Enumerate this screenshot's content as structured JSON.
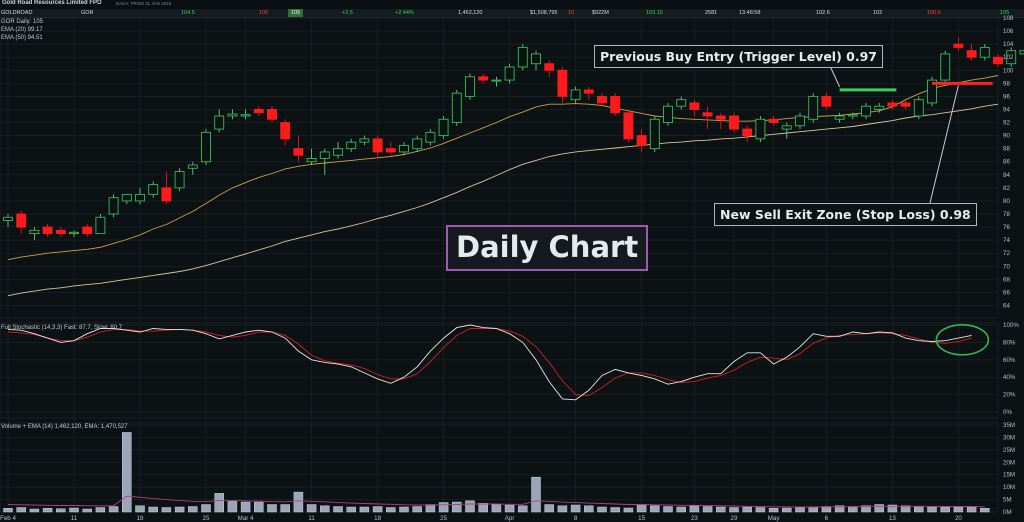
{
  "header": {
    "title": "Gold Road Resources Limited FPO",
    "subtitle": "DAILY, FROM 31 JAN 2019",
    "quotes": [
      {
        "text": "GOLDROAD",
        "kind": "plain"
      },
      {
        "text": "GOR",
        "kind": "plain"
      },
      {
        "text": "104.5",
        "kind": "up"
      },
      {
        "text": "105",
        "kind": "dn"
      },
      {
        "text": "105",
        "kind": "hl"
      },
      {
        "text": "+2.5",
        "kind": "up"
      },
      {
        "text": "+2.44%",
        "kind": "up"
      },
      {
        "text": "1,462,120",
        "kind": "plain"
      },
      {
        "text": "$1,508,795",
        "kind": "plain"
      },
      {
        "text": "10",
        "kind": "dn"
      },
      {
        "text": "$922M",
        "kind": "plain"
      },
      {
        "text": "103.15",
        "kind": "up"
      },
      {
        "text": "2581",
        "kind": "plain"
      },
      {
        "text": "13:48:58",
        "kind": "plain"
      },
      {
        "text": "102.6",
        "kind": "plain"
      },
      {
        "text": "102",
        "kind": "plain"
      },
      {
        "text": "100.6",
        "kind": "dn"
      },
      {
        "text": "105",
        "kind": "up"
      }
    ]
  },
  "annotations": {
    "buy": "Previous Buy Entry (Trigger Level) 0.97",
    "sell": "New Sell Exit Zone (Stop Loss) 0.98",
    "big": "Daily Chart"
  },
  "panel_labels": {
    "price": [
      "GOR Daily: 105",
      "EMA (20) 99.17",
      "EMA (50) 94.51"
    ],
    "stoch": "Full Stochastic (14,3,3) Fast: 87.7, Slow: 80.7",
    "volume": "Volume + EMA (14) 1,462,120, EMA: 1,470,527"
  },
  "colors": {
    "up_candle": "#2fbf55",
    "down_candle": "#ff1b1b",
    "ema20": "#c9a24a",
    "ema50": "#d9c69a",
    "stoch_fast": "#e6e6e6",
    "stoch_slow": "#cc2222",
    "volume_bar": "#9aa6b8",
    "volume_ema": "#b0407f",
    "buy_level": "#36d15a",
    "sell_level": "#ff2222",
    "highlight_circle": "#2fb84f"
  },
  "chart_data": [
    {
      "type": "candlestick",
      "title": "",
      "ylim": [
        63,
        108
      ],
      "y_ticks": [
        64,
        66,
        68,
        70,
        72,
        74,
        76,
        78,
        80,
        82,
        84,
        86,
        88,
        90,
        92,
        94,
        96,
        98,
        100,
        102,
        104,
        106,
        108
      ],
      "x_tick_labels": [
        {
          "label": "Feb 4",
          "idx": 0
        },
        {
          "label": "11",
          "idx": 5
        },
        {
          "label": "18",
          "idx": 10
        },
        {
          "label": "25",
          "idx": 15
        },
        {
          "label": "Mar 4",
          "idx": 18
        },
        {
          "label": "11",
          "idx": 23
        },
        {
          "label": "18",
          "idx": 28
        },
        {
          "label": "25",
          "idx": 33
        },
        {
          "label": "Apr",
          "idx": 38
        },
        {
          "label": "8",
          "idx": 43
        },
        {
          "label": "15",
          "idx": 48
        },
        {
          "label": "23",
          "idx": 52
        },
        {
          "label": "29",
          "idx": 55
        },
        {
          "label": "May",
          "idx": 58
        },
        {
          "label": "6",
          "idx": 62
        },
        {
          "label": "13",
          "idx": 67
        },
        {
          "label": "20",
          "idx": 72
        }
      ],
      "ohlc": [
        {
          "o": 77,
          "h": 78,
          "l": 76,
          "c": 77.5
        },
        {
          "o": 78,
          "h": 78.5,
          "l": 75,
          "c": 76
        },
        {
          "o": 75,
          "h": 76,
          "l": 74,
          "c": 75.5
        },
        {
          "o": 76,
          "h": 76.5,
          "l": 74.5,
          "c": 75
        },
        {
          "o": 75.5,
          "h": 76,
          "l": 74.5,
          "c": 75
        },
        {
          "o": 75,
          "h": 75.5,
          "l": 74.5,
          "c": 75.2
        },
        {
          "o": 76,
          "h": 76.5,
          "l": 74.5,
          "c": 75
        },
        {
          "o": 75,
          "h": 78,
          "l": 75,
          "c": 77.5
        },
        {
          "o": 78,
          "h": 81,
          "l": 77.5,
          "c": 80.5
        },
        {
          "o": 80,
          "h": 81,
          "l": 79.5,
          "c": 81
        },
        {
          "o": 80,
          "h": 82,
          "l": 79.5,
          "c": 81
        },
        {
          "o": 81,
          "h": 83,
          "l": 80.5,
          "c": 82.5
        },
        {
          "o": 82,
          "h": 84.5,
          "l": 79.5,
          "c": 80
        },
        {
          "o": 82,
          "h": 85,
          "l": 81.5,
          "c": 84.5
        },
        {
          "o": 85,
          "h": 86,
          "l": 84,
          "c": 85.5
        },
        {
          "o": 86,
          "h": 91,
          "l": 85.5,
          "c": 90.5
        },
        {
          "o": 91,
          "h": 94,
          "l": 90.5,
          "c": 93
        },
        {
          "o": 93,
          "h": 94,
          "l": 92.5,
          "c": 93.3
        },
        {
          "o": 93,
          "h": 94,
          "l": 92.5,
          "c": 93.2
        },
        {
          "o": 94,
          "h": 94.5,
          "l": 93,
          "c": 93.5
        },
        {
          "o": 94,
          "h": 94.5,
          "l": 92,
          "c": 92.5
        },
        {
          "o": 92,
          "h": 92.5,
          "l": 88.5,
          "c": 89.5
        },
        {
          "o": 88,
          "h": 90,
          "l": 86,
          "c": 87
        },
        {
          "o": 86,
          "h": 88,
          "l": 85.5,
          "c": 86.5
        },
        {
          "o": 86.5,
          "h": 88,
          "l": 84,
          "c": 87.5
        },
        {
          "o": 87,
          "h": 89,
          "l": 86.5,
          "c": 88
        },
        {
          "o": 88,
          "h": 89.5,
          "l": 87.5,
          "c": 89
        },
        {
          "o": 89,
          "h": 90,
          "l": 88.5,
          "c": 89.5
        },
        {
          "o": 89.5,
          "h": 90,
          "l": 86.5,
          "c": 87.5
        },
        {
          "o": 88,
          "h": 89,
          "l": 87,
          "c": 87.5
        },
        {
          "o": 87.5,
          "h": 89,
          "l": 87,
          "c": 88.5
        },
        {
          "o": 88,
          "h": 90,
          "l": 87.5,
          "c": 89.5
        },
        {
          "o": 89,
          "h": 91,
          "l": 88.5,
          "c": 90.5
        },
        {
          "o": 90,
          "h": 93,
          "l": 89.5,
          "c": 92.5
        },
        {
          "o": 92,
          "h": 97,
          "l": 91.5,
          "c": 96.5
        },
        {
          "o": 96,
          "h": 99.5,
          "l": 95.5,
          "c": 99
        },
        {
          "o": 99,
          "h": 99.5,
          "l": 98,
          "c": 98.5
        },
        {
          "o": 98.5,
          "h": 99,
          "l": 97.5,
          "c": 98.5
        },
        {
          "o": 98.5,
          "h": 101,
          "l": 98,
          "c": 100.5
        },
        {
          "o": 100.5,
          "h": 104,
          "l": 100,
          "c": 103.5
        },
        {
          "o": 101,
          "h": 103,
          "l": 100,
          "c": 102.5
        },
        {
          "o": 101,
          "h": 101.5,
          "l": 99,
          "c": 100
        },
        {
          "o": 100,
          "h": 100.5,
          "l": 95,
          "c": 96
        },
        {
          "o": 95.5,
          "h": 97.5,
          "l": 95,
          "c": 97
        },
        {
          "o": 97,
          "h": 97.5,
          "l": 95.5,
          "c": 96.5
        },
        {
          "o": 96,
          "h": 96.5,
          "l": 94.5,
          "c": 95
        },
        {
          "o": 96,
          "h": 96.5,
          "l": 93,
          "c": 93.5
        },
        {
          "o": 93.5,
          "h": 94,
          "l": 89,
          "c": 89.5
        },
        {
          "o": 90,
          "h": 91,
          "l": 87.5,
          "c": 88.5
        },
        {
          "o": 88,
          "h": 93,
          "l": 87.5,
          "c": 92.5
        },
        {
          "o": 92,
          "h": 95,
          "l": 91.5,
          "c": 94.5
        },
        {
          "o": 94.5,
          "h": 96,
          "l": 94,
          "c": 95.5
        },
        {
          "o": 95,
          "h": 95.5,
          "l": 93,
          "c": 94
        },
        {
          "o": 93.5,
          "h": 94.5,
          "l": 91,
          "c": 93
        },
        {
          "o": 93,
          "h": 93.5,
          "l": 91,
          "c": 92.5
        },
        {
          "o": 93,
          "h": 93.5,
          "l": 90.5,
          "c": 91
        },
        {
          "o": 91,
          "h": 91.5,
          "l": 89,
          "c": 90
        },
        {
          "o": 89.5,
          "h": 93,
          "l": 89,
          "c": 92.5
        },
        {
          "o": 92.5,
          "h": 93,
          "l": 91.5,
          "c": 92
        },
        {
          "o": 91,
          "h": 92,
          "l": 89.5,
          "c": 91.5
        },
        {
          "o": 91.5,
          "h": 93.5,
          "l": 91,
          "c": 93
        },
        {
          "o": 92.5,
          "h": 96.5,
          "l": 92,
          "c": 96
        },
        {
          "o": 96,
          "h": 96.5,
          "l": 94,
          "c": 94.5
        },
        {
          "o": 92.5,
          "h": 93.5,
          "l": 92,
          "c": 93
        },
        {
          "o": 93,
          "h": 93.5,
          "l": 92.5,
          "c": 93.2
        },
        {
          "o": 93,
          "h": 95,
          "l": 92.5,
          "c": 94.5
        },
        {
          "o": 94,
          "h": 95,
          "l": 93.5,
          "c": 94.5
        },
        {
          "o": 95,
          "h": 95.5,
          "l": 94,
          "c": 94.5
        },
        {
          "o": 95,
          "h": 95.5,
          "l": 94,
          "c": 94.5
        },
        {
          "o": 93,
          "h": 96,
          "l": 92.5,
          "c": 95.5
        },
        {
          "o": 95,
          "h": 99,
          "l": 94.5,
          "c": 98.5
        },
        {
          "o": 98.5,
          "h": 103,
          "l": 98,
          "c": 102.5
        },
        {
          "o": 104,
          "h": 105,
          "l": 103,
          "c": 103.5
        },
        {
          "o": 103,
          "h": 104,
          "l": 101.5,
          "c": 102
        },
        {
          "o": 102,
          "h": 104,
          "l": 101.5,
          "c": 103.5
        },
        {
          "o": 102,
          "h": 102.5,
          "l": 100.5,
          "c": 101
        },
        {
          "o": 101,
          "h": 103.5,
          "l": 100.5,
          "c": 103
        },
        {
          "o": 102.5,
          "h": 103.5,
          "l": 101.5,
          "c": 103
        },
        {
          "o": 102,
          "h": 105.5,
          "l": 100.5,
          "c": 105
        }
      ],
      "series": [
        {
          "name": "EMA (20)",
          "values": [
            71,
            71.4,
            71.7,
            72,
            72.2,
            72.4,
            72.6,
            72.9,
            73.5,
            74.1,
            74.8,
            75.7,
            76.4,
            77.4,
            78.4,
            79.6,
            80.9,
            82,
            82.8,
            83.6,
            84.2,
            84.9,
            85.3,
            85.6,
            85.8,
            86,
            86.2,
            86.4,
            86.6,
            86.8,
            87.1,
            87.6,
            88.1,
            88.8,
            89.6,
            90.4,
            91.2,
            92,
            92.9,
            93.6,
            94.4,
            94.8,
            94.8,
            94.9,
            94.8,
            94.6,
            94.2,
            93.8,
            93.4,
            93,
            92.8,
            92.6,
            92.5,
            92.4,
            92.3,
            92.2,
            92.2,
            92.3,
            92.4,
            92.6,
            92.8,
            92.9,
            93,
            93.1,
            93.3,
            93.5,
            93.8,
            94.4,
            95.5,
            96.4,
            97.2,
            97.7,
            98.1,
            98.5,
            98.8,
            99.2
          ]
        },
        {
          "name": "EMA (50)",
          "values": [
            65.5,
            65.9,
            66.2,
            66.5,
            66.7,
            67,
            67.2,
            67.4,
            67.7,
            68,
            68.3,
            68.6,
            68.9,
            69.2,
            69.6,
            70.1,
            70.7,
            71.3,
            71.9,
            72.5,
            73.1,
            73.8,
            74.3,
            74.8,
            75.3,
            75.7,
            76.2,
            76.7,
            77.3,
            77.8,
            78.4,
            79,
            79.7,
            80.5,
            81.3,
            82.2,
            83,
            83.9,
            84.8,
            85.6,
            86.2,
            86.8,
            87.2,
            87.5,
            87.7,
            87.9,
            88.1,
            88.3,
            88.5,
            88.7,
            88.9,
            89,
            89.2,
            89.3,
            89.5,
            89.6,
            89.8,
            90,
            90.2,
            90.4,
            90.6,
            90.8,
            91,
            91.2,
            91.4,
            91.7,
            92,
            92.3,
            92.7,
            93,
            93.2,
            93.5,
            93.8,
            94.1,
            94.5,
            94.8
          ]
        }
      ],
      "buy_level": 97,
      "sell_level": 98
    },
    {
      "type": "line",
      "title": "Full Stochastic (14,3,3)",
      "ylim": [
        0,
        100
      ],
      "y_ticks": [
        0,
        20,
        40,
        60,
        80,
        100
      ],
      "series": [
        {
          "name": "Fast",
          "values": [
            95,
            94,
            90,
            85,
            80,
            82,
            90,
            96,
            96,
            94,
            92,
            96,
            95,
            95,
            94,
            90,
            84,
            88,
            92,
            94,
            92,
            85,
            70,
            60,
            57,
            55,
            52,
            45,
            38,
            33,
            40,
            52,
            70,
            85,
            97,
            100,
            97,
            96,
            90,
            80,
            60,
            35,
            15,
            14,
            25,
            42,
            49,
            45,
            42,
            38,
            32,
            35,
            40,
            44,
            44,
            58,
            68,
            68,
            55,
            63,
            75,
            90,
            87,
            87,
            92,
            90,
            92,
            91,
            85,
            82,
            81,
            82,
            85,
            88
          ]
        },
        {
          "name": "Slow",
          "values": [
            92,
            91,
            89,
            85,
            82,
            82,
            86,
            92,
            95,
            95,
            93,
            93,
            94,
            95,
            94,
            92,
            88,
            86,
            88,
            92,
            92,
            88,
            78,
            65,
            59,
            56,
            54,
            50,
            43,
            38,
            38,
            44,
            58,
            74,
            88,
            96,
            96,
            96,
            93,
            87,
            75,
            57,
            36,
            20,
            19,
            28,
            39,
            45,
            45,
            42,
            37,
            34,
            35,
            39,
            42,
            48,
            57,
            63,
            62,
            60,
            67,
            79,
            85,
            88,
            89,
            90,
            91,
            90,
            88,
            84,
            80,
            79,
            81,
            85
          ]
        }
      ]
    },
    {
      "type": "bar",
      "title": "Volume + EMA (14)",
      "ylim": [
        0,
        35
      ],
      "y_ticks": [
        0,
        5,
        10,
        15,
        20,
        25,
        30,
        35
      ],
      "y_tick_labels": [
        "0M",
        "5M",
        "10M",
        "15M",
        "20M",
        "25M",
        "30M",
        "35M"
      ],
      "values": [
        1.5,
        1.8,
        1.2,
        1.5,
        1.3,
        1.6,
        1.2,
        1.8,
        2.2,
        32,
        2.5,
        2,
        1.8,
        2,
        2.2,
        3,
        7.5,
        4.5,
        4,
        4,
        3,
        3,
        8,
        3,
        2.5,
        2.2,
        2,
        2,
        2.2,
        1.8,
        2,
        2.2,
        3,
        3.8,
        4,
        4.5,
        3.5,
        3,
        2.8,
        2.5,
        14,
        3,
        2.5,
        2.8,
        2.5,
        2,
        1.8,
        1.6,
        3,
        2.5,
        2.2,
        2,
        2.5,
        2.2,
        2,
        1.8,
        2,
        1.8,
        1.5,
        1.6,
        1.8,
        2,
        2.2,
        2.5,
        2.2,
        2.5,
        3,
        2.8,
        2.5,
        2.2,
        2,
        2,
        2,
        2.2,
        1.5
      ],
      "series": [
        {
          "name": "EMA",
          "values": [
            3,
            2.9,
            2.8,
            2.7,
            2.6,
            2.6,
            2.5,
            2.5,
            2.5,
            6.4,
            5.9,
            5.4,
            5,
            4.6,
            4.3,
            4.2,
            4.6,
            4.6,
            4.5,
            4.4,
            4.2,
            4.1,
            4.5,
            4.3,
            4.1,
            3.8,
            3.6,
            3.4,
            3.2,
            3.1,
            2.9,
            2.8,
            2.8,
            2.9,
            3,
            3.2,
            3.2,
            3.2,
            3.1,
            3.1,
            4.5,
            4.3,
            4,
            3.8,
            3.6,
            3.4,
            3.2,
            3,
            3,
            2.9,
            2.8,
            2.7,
            2.7,
            2.6,
            2.5,
            2.4,
            2.3,
            2.2,
            2.1,
            2.1,
            2,
            2,
            2.1,
            2.1,
            2.1,
            2.2,
            2.3,
            2.3,
            2.3,
            2.3,
            2.3,
            2.2,
            2.2,
            2.2,
            2.1
          ]
        }
      ]
    }
  ]
}
